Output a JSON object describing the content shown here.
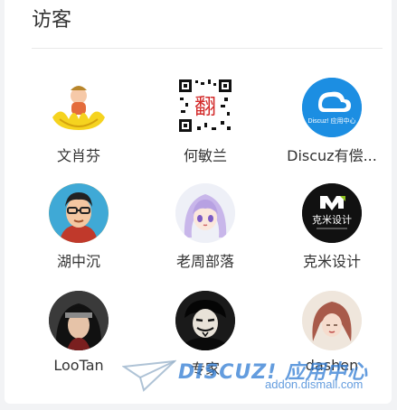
{
  "panel": {
    "title": "访客"
  },
  "visitors": [
    {
      "name": "文肖芬",
      "avatar_icon": "lotus-buddha-icon"
    },
    {
      "name": "何敏兰",
      "avatar_icon": "qr-seal-icon"
    },
    {
      "name": "Discuz有偿...",
      "avatar_icon": "discuz-cloud-logo-icon"
    },
    {
      "name": "湖中沉",
      "avatar_icon": "cartoon-man-glasses-icon"
    },
    {
      "name": "老周部落",
      "avatar_icon": "anime-girl-icon"
    },
    {
      "name": "克米设计",
      "avatar_icon": "kemi-logo-icon"
    },
    {
      "name": "LooTan",
      "avatar_icon": "ninja-character-icon"
    },
    {
      "name": "专家",
      "avatar_icon": "mask-icon"
    },
    {
      "name": "dashen",
      "avatar_icon": "sketch-girl-icon"
    }
  ],
  "discuz_badge_text": "Discuz! 应用中心",
  "watermark": {
    "brand": "DISCUZ! 应用中心",
    "url": "addon.dismall.com"
  },
  "colors": {
    "accent": "#2f7bd3",
    "text": "#333333",
    "divider": "#e9e9e9"
  }
}
